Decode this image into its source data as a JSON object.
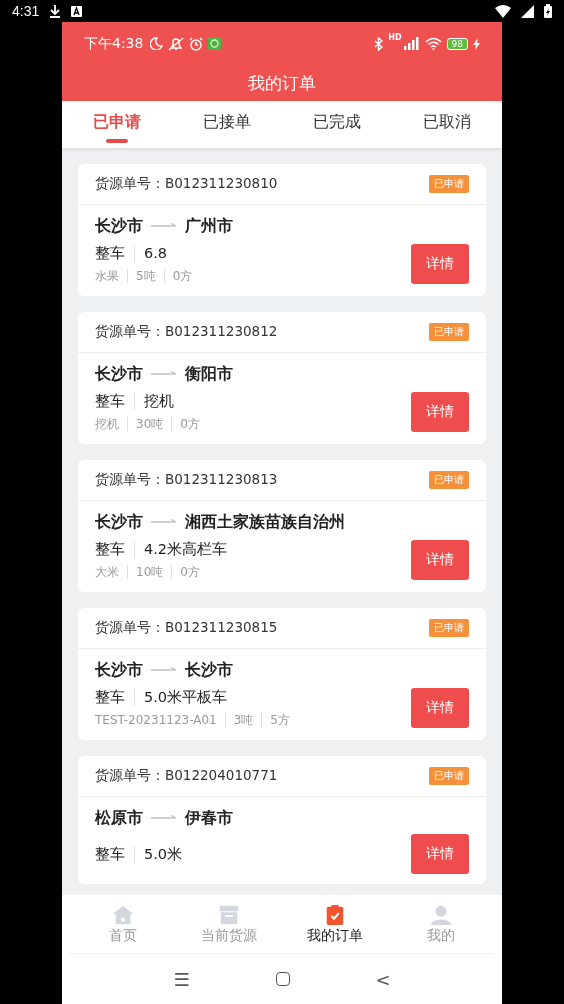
{
  "system_status": {
    "time": "4:31"
  },
  "app_status": {
    "time": "下午4:38",
    "network": "HD",
    "battery": "98"
  },
  "header": {
    "title": "我的订单"
  },
  "tabs": [
    {
      "label": "已申请",
      "selected": true
    },
    {
      "label": "已接单",
      "selected": false
    },
    {
      "label": "已完成",
      "selected": false
    },
    {
      "label": "已取消",
      "selected": false
    }
  ],
  "orders": [
    {
      "number_label": "货源单号：",
      "number": "B012311230810",
      "status": "已申请",
      "from": "长沙市",
      "to": "广州市",
      "mode": "整车",
      "vehicle": "6.8",
      "specs": [
        "水果",
        "5吨",
        "0方"
      ],
      "action": "详情"
    },
    {
      "number_label": "货源单号：",
      "number": "B012311230812",
      "status": "已申请",
      "from": "长沙市",
      "to": "衡阳市",
      "mode": "整车",
      "vehicle": "挖机",
      "specs": [
        "挖机",
        "30吨",
        "0方"
      ],
      "action": "详情"
    },
    {
      "number_label": "货源单号：",
      "number": "B012311230813",
      "status": "已申请",
      "from": "长沙市",
      "to": "湘西土家族苗族自治州",
      "mode": "整车",
      "vehicle": "4.2米高栏车",
      "specs": [
        "大米",
        "10吨",
        "0方"
      ],
      "action": "详情"
    },
    {
      "number_label": "货源单号：",
      "number": "B012311230815",
      "status": "已申请",
      "from": "长沙市",
      "to": "长沙市",
      "mode": "整车",
      "vehicle": "5.0米平板车",
      "specs": [
        "TEST-20231123-A01",
        "3吨",
        "5方"
      ],
      "action": "详情"
    },
    {
      "number_label": "货源单号：",
      "number": "B012204010771",
      "status": "已申请",
      "from": "松原市",
      "to": "伊春市",
      "mode": "整车",
      "vehicle": "5.0米",
      "action": "详情"
    }
  ],
  "bottom_nav": [
    {
      "label": "首页",
      "kind": "home",
      "selected": false
    },
    {
      "label": "当前货源",
      "kind": "box",
      "selected": false
    },
    {
      "label": "我的订单",
      "kind": "orders",
      "selected": true
    },
    {
      "label": "我的",
      "kind": "user",
      "selected": false
    }
  ],
  "system_nav": {
    "menu": "☰",
    "back": "<"
  }
}
